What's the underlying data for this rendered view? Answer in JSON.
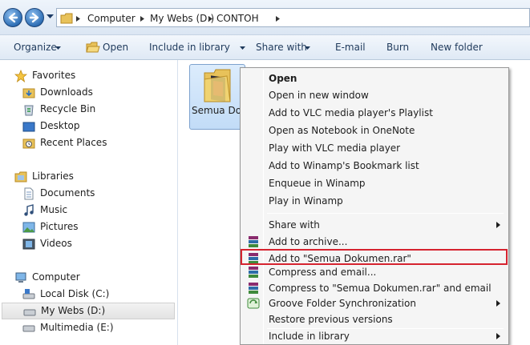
{
  "address": {
    "crumbs": [
      "Computer",
      "My Webs (D:)",
      "CONTOH"
    ]
  },
  "toolbar": {
    "organize": "Organize",
    "open": "Open",
    "include": "Include in library",
    "share": "Share with",
    "email": "E-mail",
    "burn": "Burn",
    "new_folder": "New folder"
  },
  "nav": {
    "favorites": "Favorites",
    "downloads": "Downloads",
    "recycle": "Recycle Bin",
    "desktop": "Desktop",
    "recent": "Recent Places",
    "libraries": "Libraries",
    "documents": "Documents",
    "music": "Music",
    "pictures": "Pictures",
    "videos": "Videos",
    "computer": "Computer",
    "local_c": "Local Disk (C:)",
    "webs_d": "My Webs (D:)",
    "multimedia_e": "Multimedia (E:)"
  },
  "content": {
    "file_label": "Semua Dokumen"
  },
  "menu": {
    "open": "Open",
    "open_new_window": "Open in new window",
    "vlc_playlist": "Add to VLC media player's Playlist",
    "onenote": "Open as Notebook in OneNote",
    "vlc_play": "Play with VLC media player",
    "winamp_bookmark": "Add to Winamp's Bookmark list",
    "winamp_enqueue": "Enqueue in Winamp",
    "winamp_play": "Play in Winamp",
    "share_with": "Share with",
    "add_archive": "Add to archive...",
    "add_rar": "Add to \"Semua Dokumen.rar\"",
    "compress_email": "Compress and email...",
    "compress_rar_email": "Compress to \"Semua Dokumen.rar\" and email",
    "groove": "Groove Folder Synchronization",
    "restore": "Restore previous versions",
    "include_library": "Include in library"
  },
  "colors": {
    "highlight_border": "#d6232f",
    "selection_blue": "#c2dcf7"
  }
}
